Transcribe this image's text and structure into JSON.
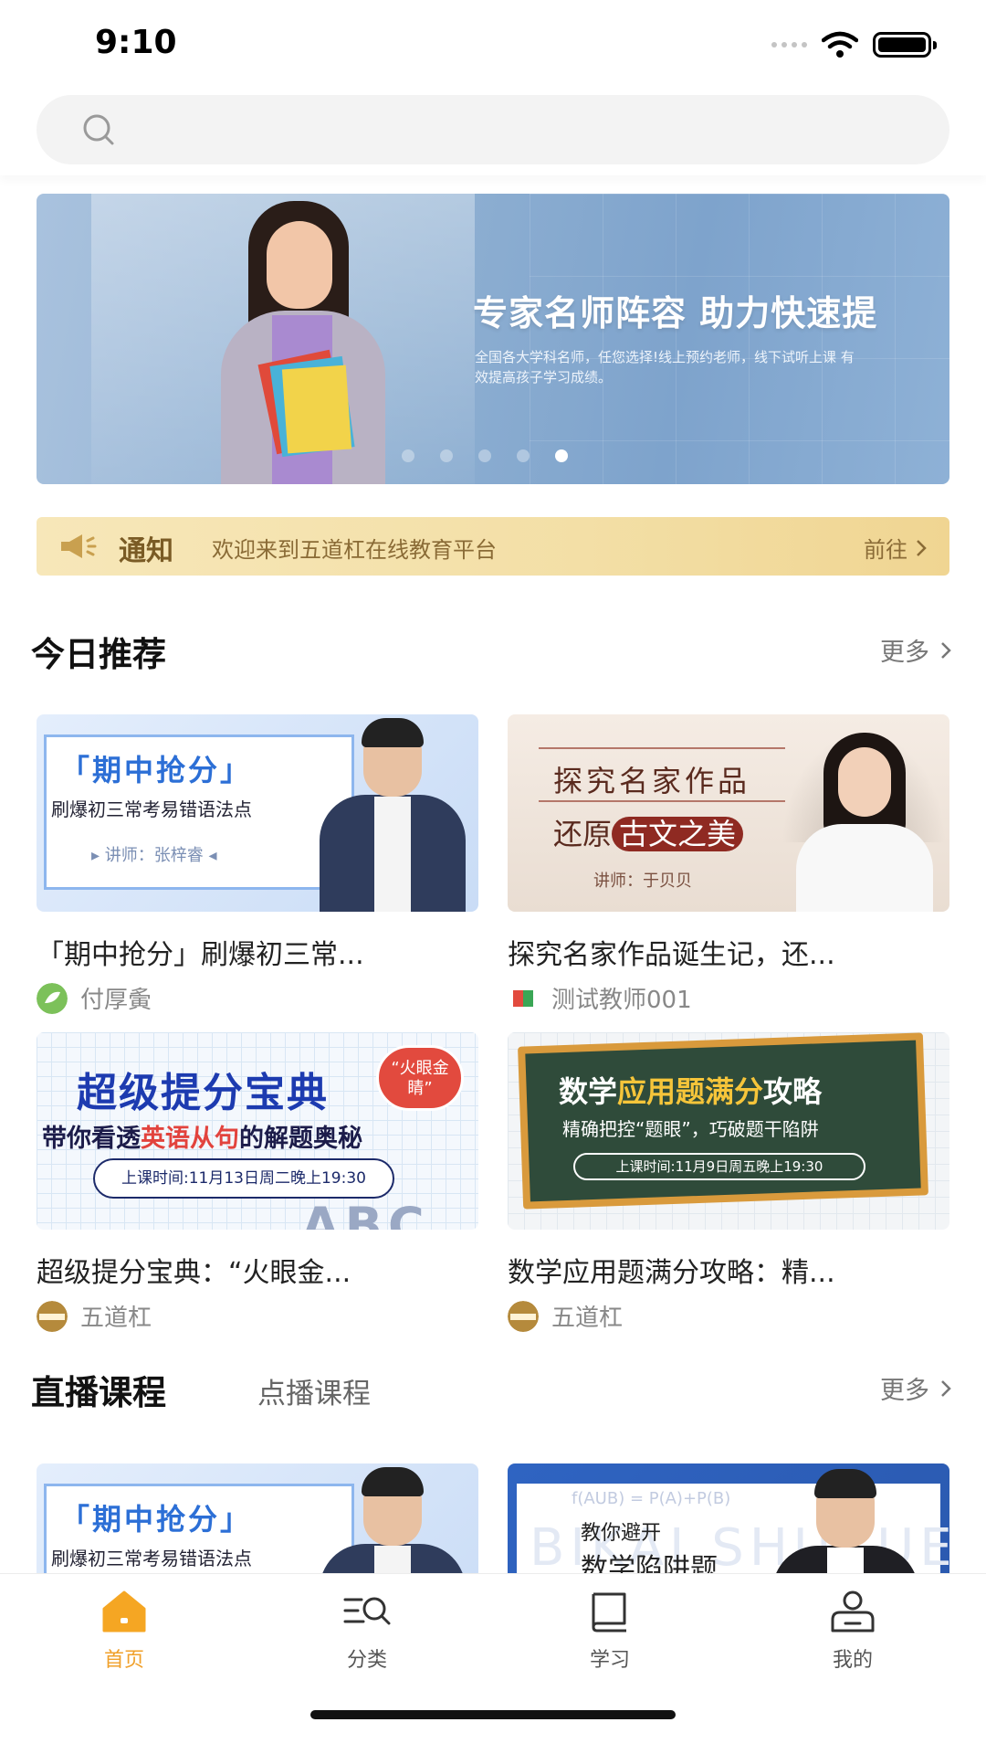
{
  "status_bar": {
    "time": "9:10"
  },
  "search": {
    "placeholder": ""
  },
  "banner": {
    "title": "专家名师阵容  助力快速提",
    "subtitle": "全国各大学科名师，任您选择!线上预约老师，线下试听上课 有效提高孩子学习成绩。",
    "slide_count": 5,
    "active_slide": 5
  },
  "notice": {
    "label": "通知",
    "text": "欢迎来到五道杠在线教育平台",
    "action": "前往"
  },
  "recommend": {
    "title": "今日推荐",
    "more": "更多",
    "courses": [
      {
        "title": "「期中抢分」刷爆初三常...",
        "author": "付厚夤",
        "thumb": {
          "line1": "「期中抢分」",
          "line2": "刷爆初三常考易错语法点",
          "line3": "▸ 讲师：张梓睿 ◂"
        }
      },
      {
        "title": "探究名家作品诞生记，还...",
        "author": "测试教师001",
        "thumb": {
          "line1": "探究名家作品",
          "line2a": "还原",
          "line2b": "古文之美",
          "line3": "讲师：于贝贝"
        }
      },
      {
        "title": "超级提分宝典：“火眼金...",
        "author": "五道杠",
        "thumb": {
          "line1": "超级提分宝典",
          "bubble": "“火眼金睛”",
          "line2a": "带你看透",
          "line2b": "英语从句",
          "line2c": "的解题奥秘",
          "line3": "上课时间:11月13日周二晚上19:30",
          "deco": "ABC"
        }
      },
      {
        "title": "数学应用题满分攻略：精...",
        "author": "五道杠",
        "thumb": {
          "line1a": "数学",
          "line1b": "应用题满分",
          "line1c": "攻略",
          "line2": "精确把控“题眼”，巧破题干陷阱",
          "line3": "上课时间:11月9日周五晚上19:30"
        }
      }
    ]
  },
  "live": {
    "tab_live": "直播课程",
    "tab_vod": "点播课程",
    "more": "更多",
    "courses": [
      {
        "thumb": {
          "line1": "「期中抢分」",
          "line2": "刷爆初三常考易错语法点"
        }
      },
      {
        "thumb": {
          "formula": "f(AUB) = P(A)+P(B)",
          "bigtext": "BIKAI SHUXUE",
          "line1": "教你避开",
          "line2": "数学陷阱题"
        }
      }
    ]
  },
  "tabbar": {
    "items": [
      {
        "label": "首页",
        "icon": "home-icon",
        "active": true
      },
      {
        "label": "分类",
        "icon": "category-search-icon",
        "active": false
      },
      {
        "label": "学习",
        "icon": "book-icon",
        "active": false
      },
      {
        "label": "我的",
        "icon": "profile-icon",
        "active": false
      }
    ],
    "accent": "#f0a02a"
  }
}
